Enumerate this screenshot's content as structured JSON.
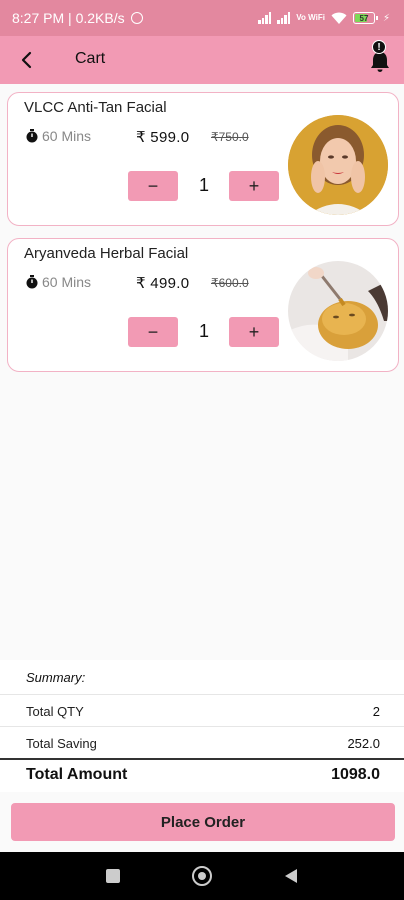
{
  "status": {
    "time": "8:27 PM",
    "speed": "0.2KB/s",
    "network": "Vo WiFi",
    "battery": "57"
  },
  "header": {
    "title": "Cart",
    "badge": "!"
  },
  "cart": [
    {
      "name": "VLCC Anti-Tan Facial",
      "duration": "60 Mins",
      "price": "₹ 599.0",
      "mrp": "₹750.0",
      "qty": "1"
    },
    {
      "name": "Aryanveda Herbal Facial",
      "duration": "60 Mins",
      "price": "₹ 499.0",
      "mrp": "₹600.0",
      "qty": "1"
    }
  ],
  "controls": {
    "minus": "−",
    "plus": "+"
  },
  "summary": {
    "label": "Summary:",
    "total_qty_label": "Total QTY",
    "total_qty": "2",
    "total_saving_label": "Total Saving",
    "total_saving": "252.0",
    "total_amount_label": "Total Amount",
    "total_amount": "1098.0"
  },
  "actions": {
    "place_order": "Place Order"
  },
  "colors": {
    "status_bar": "#e3889f",
    "app_bar": "#f29ab4",
    "card_border": "#f2b2c5"
  }
}
